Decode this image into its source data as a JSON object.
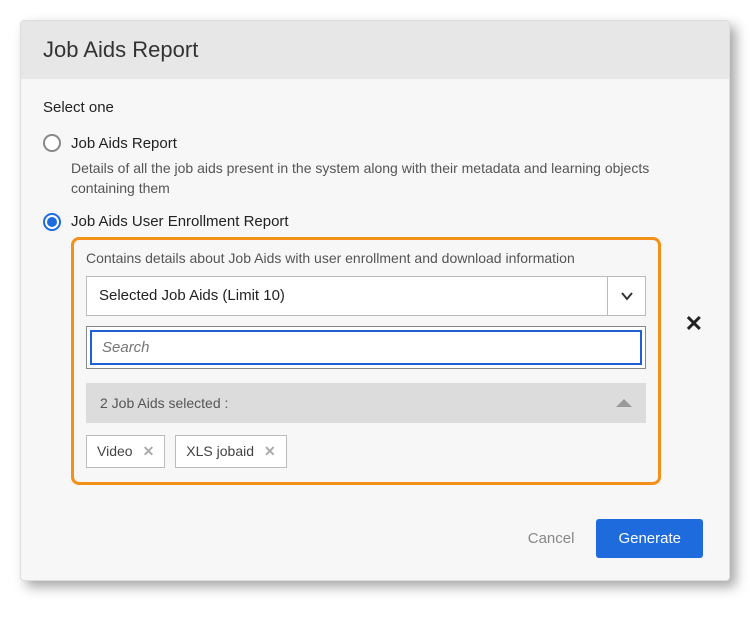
{
  "dialog": {
    "title": "Job Aids Report",
    "prompt": "Select one",
    "options": [
      {
        "label": "Job Aids Report",
        "description": "Details of all the job aids present in the system along with their metadata and learning objects containing them",
        "selected": false
      },
      {
        "label": "Job Aids User Enrollment Report",
        "description": "Contains details about Job Aids with user enrollment and download information",
        "selected": true
      }
    ],
    "dropdown": {
      "label": "Selected Job Aids (Limit 10)"
    },
    "search": {
      "placeholder": "Search",
      "value": ""
    },
    "selected_summary": "2 Job Aids selected :",
    "selected_items": [
      "Video",
      "XLS jobaid"
    ],
    "actions": {
      "cancel": "Cancel",
      "generate": "Generate"
    }
  }
}
